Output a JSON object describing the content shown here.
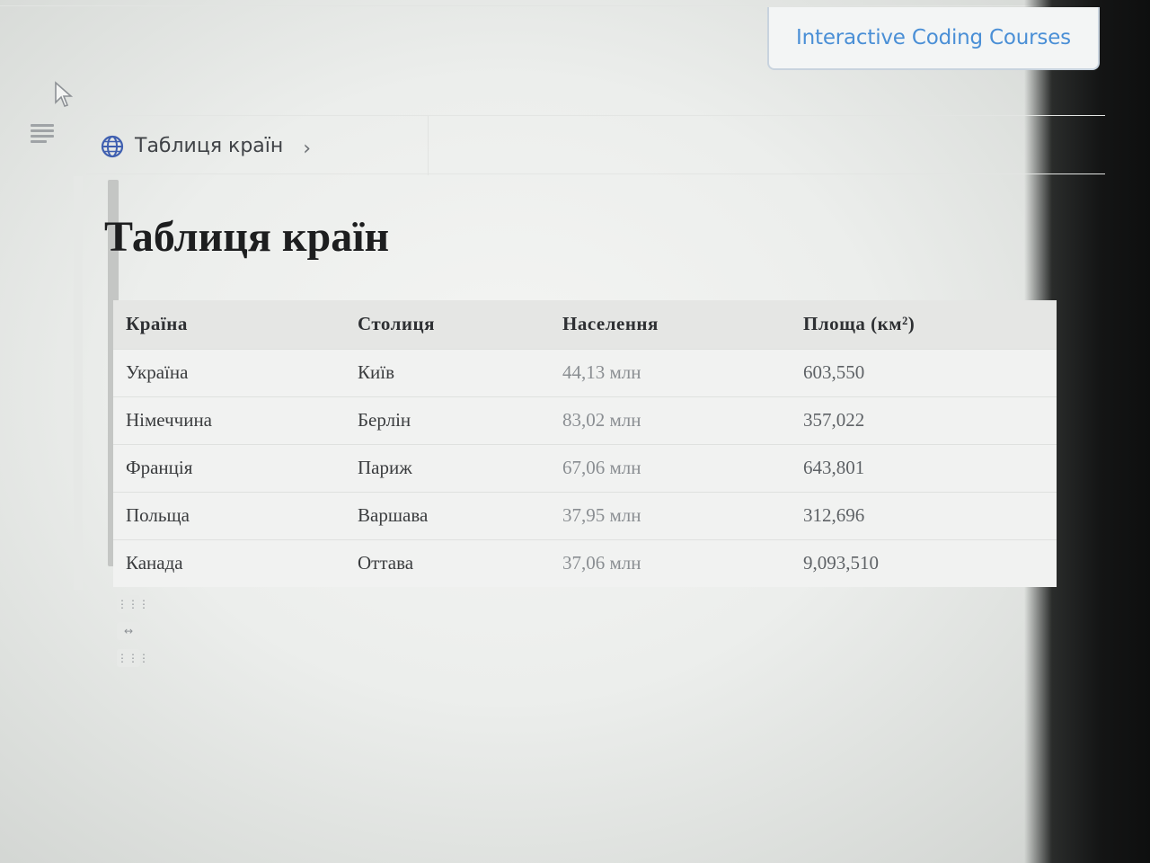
{
  "header": {
    "courses_button": "Interactive Coding Courses"
  },
  "breadcrumb": {
    "label": "Таблиця країн",
    "icon": "globe-icon"
  },
  "page": {
    "title": "Таблиця країн"
  },
  "table": {
    "columns": [
      "Країна",
      "Столиця",
      "Населення",
      "Площа (км²)"
    ],
    "rows": [
      [
        "Україна",
        "Київ",
        "44,13 млн",
        "603,550"
      ],
      [
        "Німеччина",
        "Берлін",
        "83,02 млн",
        "357,022"
      ],
      [
        "Франція",
        "Париж",
        "67,06 млн",
        "643,801"
      ],
      [
        "Польща",
        "Варшава",
        "37,95 млн",
        "312,696"
      ],
      [
        "Канада",
        "Оттава",
        "37,06 млн",
        "9,093,510"
      ]
    ]
  },
  "table_handles": [
    "⋮⋮⋮",
    "↔",
    "⋮⋮⋮"
  ],
  "colors": {
    "accent_link": "#4a8fd6",
    "globe": "#3f5fb0",
    "title": "#1d1e1f"
  }
}
